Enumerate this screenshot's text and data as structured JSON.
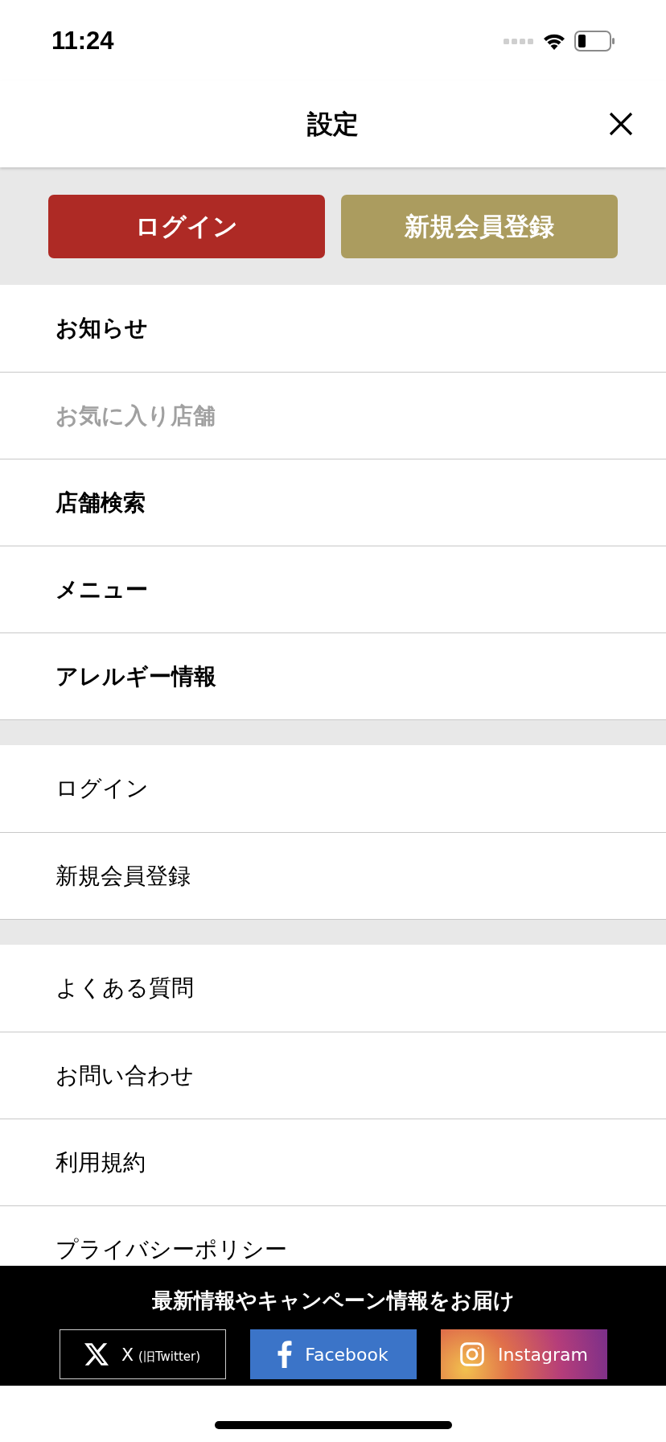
{
  "status_bar": {
    "time": "11:24"
  },
  "header": {
    "title": "設定"
  },
  "top_buttons": [
    {
      "label": "ログイン",
      "kind": "primary"
    },
    {
      "label": "新規会員登録",
      "kind": "secondary"
    }
  ],
  "sections": [
    {
      "items": [
        {
          "label": "お知らせ",
          "bold": true,
          "disabled": false
        },
        {
          "label": "お気に入り店舗",
          "bold": true,
          "disabled": true
        },
        {
          "label": "店舗検索",
          "bold": true,
          "disabled": false
        },
        {
          "label": "メニュー",
          "bold": true,
          "disabled": false
        },
        {
          "label": "アレルギー情報",
          "bold": true,
          "disabled": false
        }
      ]
    },
    {
      "items": [
        {
          "label": "ログイン",
          "bold": false,
          "disabled": false
        },
        {
          "label": "新規会員登録",
          "bold": false,
          "disabled": false
        }
      ]
    },
    {
      "items": [
        {
          "label": "よくある質問",
          "bold": false,
          "disabled": false
        },
        {
          "label": "お問い合わせ",
          "bold": false,
          "disabled": false
        },
        {
          "label": "利用規約",
          "bold": false,
          "disabled": false
        },
        {
          "label": "プライバシーポリシー",
          "bold": false,
          "disabled": false
        }
      ]
    }
  ],
  "footer": {
    "heading": "最新情報やキャンペーン情報をお届け",
    "links": [
      {
        "kind": "x",
        "label": "X",
        "note": "(旧Twitter)"
      },
      {
        "kind": "facebook",
        "label": "Facebook"
      },
      {
        "kind": "instagram",
        "label": "Instagram"
      }
    ]
  }
}
